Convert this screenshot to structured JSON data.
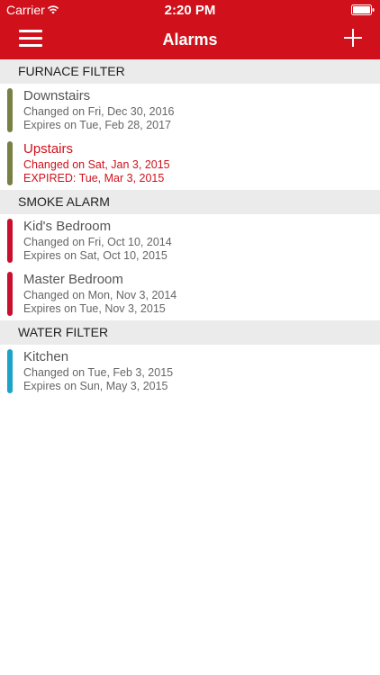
{
  "status_bar": {
    "carrier": "Carrier",
    "time": "2:20 PM"
  },
  "header": {
    "title": "Alarms",
    "menu_icon": "menu-icon",
    "add_icon": "add-icon"
  },
  "colors": {
    "brand": "#d0111b",
    "furnace": "#7a7f45",
    "smoke": "#c8102e",
    "water": "#1ba3c9",
    "section_bg": "#ebebeb"
  },
  "sections": [
    {
      "label": "FURNACE FILTER",
      "items": [
        {
          "title": "Downstairs",
          "changed": "Changed on Fri, Dec 30, 2016",
          "expires": "Expires on Tue, Feb 28, 2017"
        },
        {
          "title": "Upstairs",
          "changed": "Changed on Sat, Jan 3, 2015",
          "expires": "EXPIRED: Tue, Mar 3, 2015"
        }
      ]
    },
    {
      "label": "SMOKE ALARM",
      "items": [
        {
          "title": "Kid's Bedroom",
          "changed": "Changed on Fri, Oct 10, 2014",
          "expires": "Expires on Sat, Oct 10, 2015"
        },
        {
          "title": "Master Bedroom",
          "changed": "Changed on Mon, Nov 3, 2014",
          "expires": "Expires on Tue, Nov 3, 2015"
        }
      ]
    },
    {
      "label": "WATER FILTER",
      "items": [
        {
          "title": "Kitchen",
          "changed": "Changed on Tue, Feb 3, 2015",
          "expires": "Expires on Sun, May 3, 2015"
        }
      ]
    }
  ]
}
